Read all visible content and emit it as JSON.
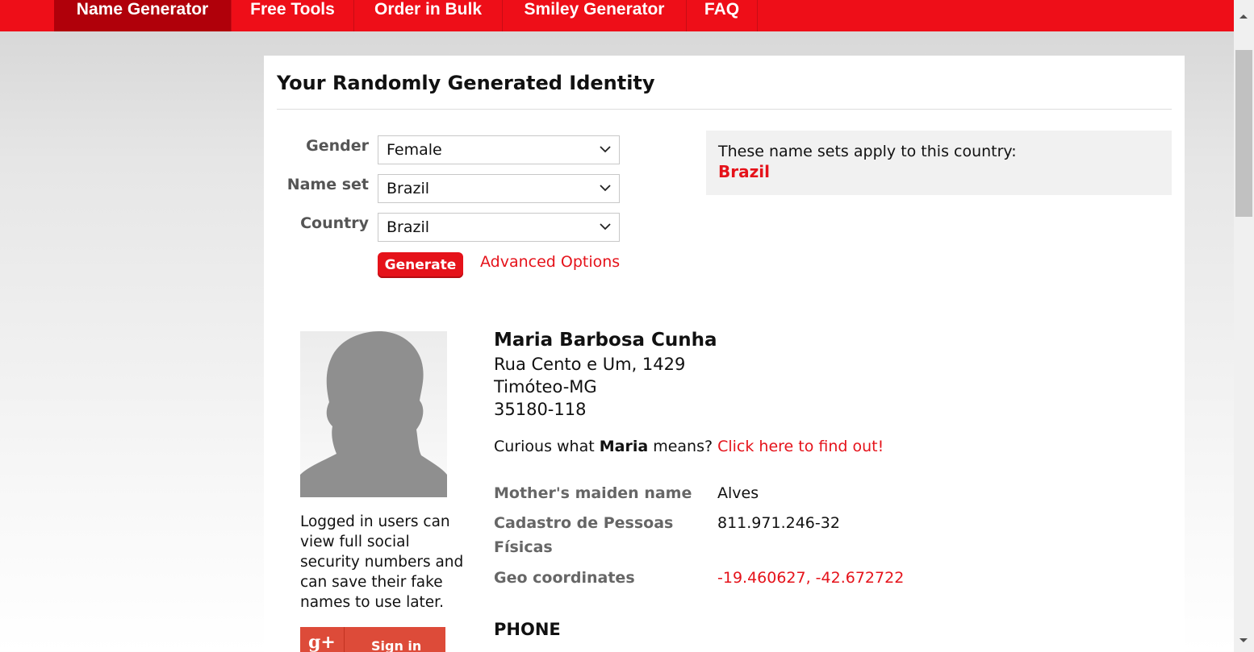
{
  "nav": {
    "items": [
      {
        "label": "Name Generator",
        "active": true
      },
      {
        "label": "Free Tools"
      },
      {
        "label": "Order in Bulk"
      },
      {
        "label": "Smiley Generator"
      },
      {
        "label": "FAQ"
      }
    ]
  },
  "page": {
    "title": "Your Randomly Generated Identity"
  },
  "form": {
    "gender_label": "Gender",
    "gender_value": "Female",
    "nameset_label": "Name set",
    "nameset_value": "Brazil",
    "country_label": "Country",
    "country_value": "Brazil",
    "generate_label": "Generate",
    "advanced_label": "Advanced Options"
  },
  "info": {
    "text": "These name sets apply to this country:",
    "country": "Brazil"
  },
  "identity": {
    "name": "Maria Barbosa Cunha",
    "address_line1": "Rua Cento e Um, 1429",
    "address_line2": "Timóteo-MG",
    "address_line3": "35180-118",
    "curious_prefix": "Curious what ",
    "first_name": "Maria",
    "curious_suffix": " means? ",
    "curious_link": "Click here to find out!",
    "login_notice": "Logged in users can view full social security numbers and can save their fake names to use later.",
    "gplus_label": "Sign in",
    "details": [
      {
        "label": "Mother's maiden name",
        "value": "Alves"
      },
      {
        "label": "Cadastro de Pessoas Físicas",
        "value": "811.971.246-32"
      },
      {
        "label": "Geo coordinates",
        "value": "-19.460627, -42.672722"
      }
    ],
    "phone_heading": "PHONE"
  },
  "colors": {
    "brand_red": "#ee0e18",
    "nav_active": "#b0000a",
    "link_red": "#e5121a"
  }
}
